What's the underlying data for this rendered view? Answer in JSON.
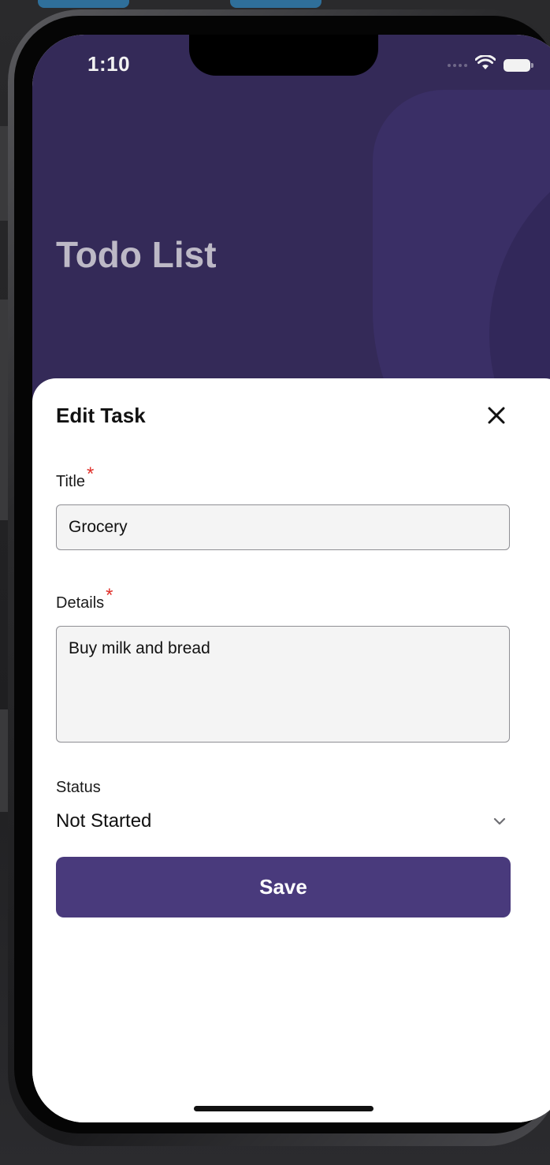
{
  "status_bar": {
    "time": "1:10",
    "icons": [
      "signal-dots-icon",
      "wifi-icon",
      "battery-icon"
    ]
  },
  "header": {
    "title": "Todo List",
    "background_color": "#342a58"
  },
  "edit_sheet": {
    "heading": "Edit Task",
    "close_icon": "close-icon",
    "title_field": {
      "label": "Title",
      "required_marker": "*",
      "value": "Grocery"
    },
    "details_field": {
      "label": "Details",
      "required_marker": "*",
      "value": "Buy milk and bread"
    },
    "status_field": {
      "label": "Status",
      "selected": "Not Started",
      "icon": "chevron-down-icon"
    },
    "save_label": "Save",
    "accent_color": "#493a7c",
    "required_color": "#e0302a"
  }
}
